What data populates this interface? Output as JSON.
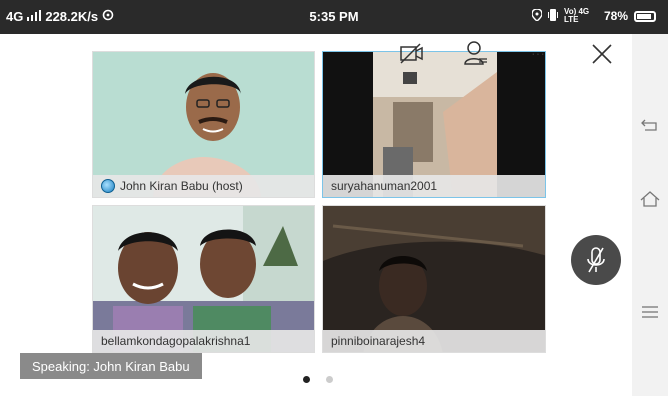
{
  "status_bar": {
    "network": "4G",
    "speed": "228.2K/s",
    "time": "5:35 PM",
    "lte_label": "Vo) 4G LTE",
    "battery": "78%"
  },
  "top_controls": {
    "more_label": "···"
  },
  "participants": [
    {
      "name": "John Kiran Babu (host)"
    },
    {
      "name": "suryahanuman2001"
    },
    {
      "name": "bellamkondagopalakrishna1"
    },
    {
      "name": "pinniboinarajesh4"
    }
  ],
  "speaking_banner": "Speaking: John Kiran Babu",
  "pagination": {
    "current": 1,
    "total": 2
  }
}
